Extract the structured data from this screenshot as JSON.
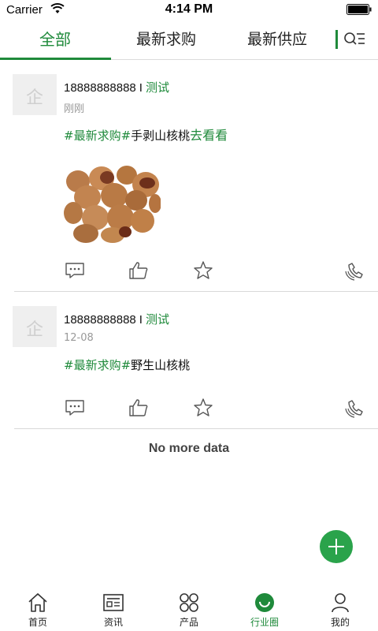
{
  "status_bar": {
    "carrier": "Carrier",
    "time": "4:14 PM"
  },
  "tabs": [
    {
      "label": "全部",
      "active": true
    },
    {
      "label": "最新求购",
      "active": false
    },
    {
      "label": "最新供应",
      "active": false
    }
  ],
  "posts": [
    {
      "avatar_glyph": "企",
      "phone": "18888888888",
      "separator": "I",
      "tag": "测试",
      "time": "刚刚",
      "topic": "#最新求购#",
      "text": "手剥山核桃",
      "link": "去看看",
      "has_image": true
    },
    {
      "avatar_glyph": "企",
      "phone": "18888888888",
      "separator": "I",
      "tag": "测试",
      "time": "12-08",
      "topic": "#最新求购#",
      "text": "野生山核桃"
    }
  ],
  "footer_text": "No more data",
  "bottom_nav": [
    {
      "label": "首页",
      "icon": "home-icon",
      "active": false
    },
    {
      "label": "资讯",
      "icon": "news-icon",
      "active": false
    },
    {
      "label": "产品",
      "icon": "products-icon",
      "active": false
    },
    {
      "label": "行业圈",
      "icon": "circle-icon",
      "active": true
    },
    {
      "label": "我的",
      "icon": "profile-icon",
      "active": false
    }
  ],
  "colors": {
    "accent": "#1f8a3b",
    "fab": "#2aa34b",
    "divider": "#d9d9d9"
  }
}
